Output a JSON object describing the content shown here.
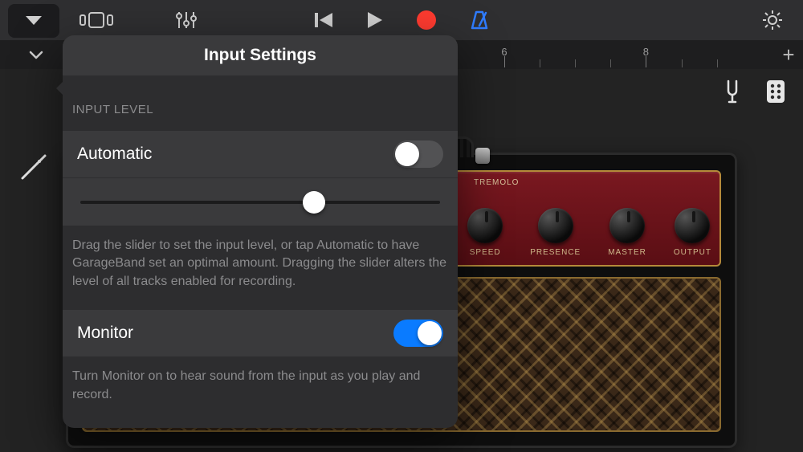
{
  "topbar": {
    "icons": {
      "dropdown": "chevron-down",
      "views": "track-view",
      "fx": "mixer",
      "rewind": "rewind",
      "play": "play",
      "record": "record",
      "metronome": "metronome",
      "settings": "gear"
    }
  },
  "ruler": {
    "markers": [
      6,
      8
    ],
    "add_label": "+"
  },
  "stage": {
    "tuning_fork": "tuning-fork",
    "tone_grid": "tone-grid"
  },
  "amp": {
    "section_label": "TREMOLO",
    "knobs": [
      "SPEED",
      "PRESENCE",
      "MASTER",
      "OUTPUT"
    ]
  },
  "popover": {
    "title": "Input Settings",
    "section_label": "INPUT LEVEL",
    "automatic": {
      "label": "Automatic",
      "enabled": false
    },
    "level_slider_value": 0.65,
    "level_help": "Drag the slider to set the input level, or tap Automatic to have GarageBand set an optimal amount. Dragging the slider alters the level of all tracks enabled for recording.",
    "monitor": {
      "label": "Monitor",
      "enabled": true
    },
    "monitor_help": "Turn Monitor on to hear sound from the input as you play and record."
  }
}
